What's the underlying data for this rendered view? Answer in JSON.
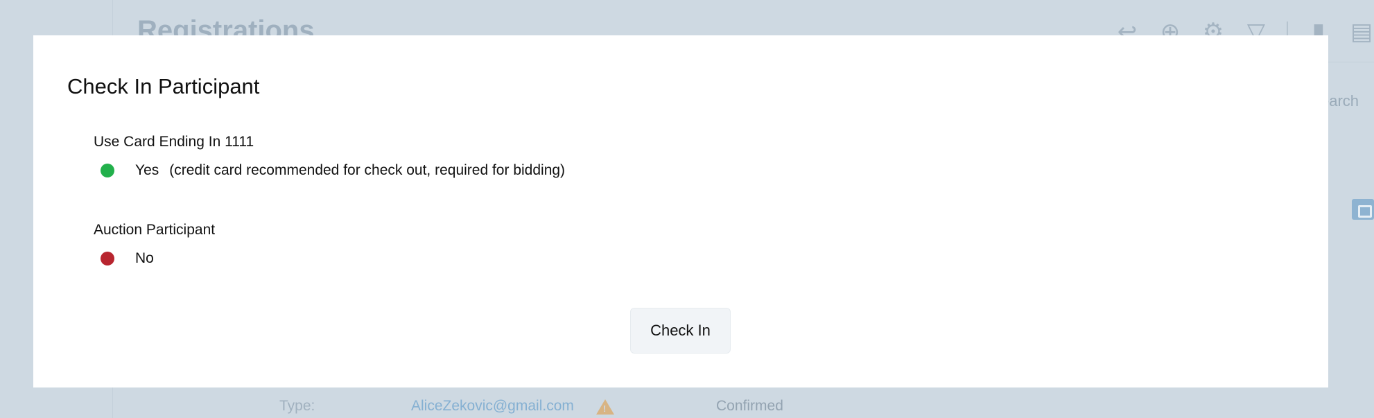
{
  "background": {
    "page_title": "Registrations",
    "search_text": "earch",
    "row": {
      "type_label": "Type:",
      "email": "AliceZekovic@gmail.com",
      "status": "Confirmed"
    },
    "toolbar_icons": [
      "back-arrow-icon",
      "add-circle-icon",
      "settings-icon",
      "filter-icon",
      "bar-chart-icon",
      "export-icon"
    ]
  },
  "modal": {
    "title": "Check In Participant",
    "card_field": {
      "label": "Use Card Ending In 1111",
      "value": "Yes",
      "note": "(credit card recommended for check out, required for bidding)",
      "indicator_color": "#22b04b"
    },
    "auction_field": {
      "label": "Auction Participant",
      "value": "No",
      "indicator_color": "#b8252f"
    },
    "check_in_label": "Check In"
  }
}
